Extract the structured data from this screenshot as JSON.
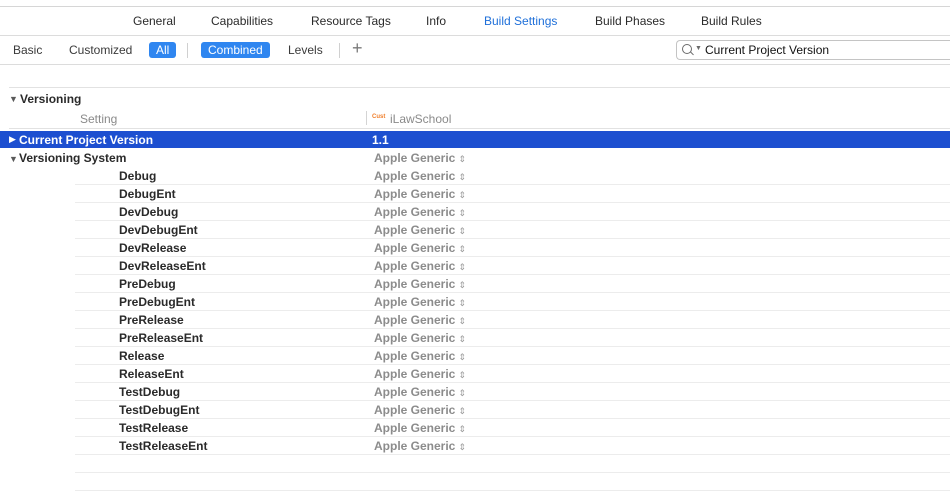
{
  "tabs": [
    {
      "label": "General",
      "active": false
    },
    {
      "label": "Capabilities",
      "active": false
    },
    {
      "label": "Resource Tags",
      "active": false
    },
    {
      "label": "Info",
      "active": false
    },
    {
      "label": "Build Settings",
      "active": true
    },
    {
      "label": "Build Phases",
      "active": false
    },
    {
      "label": "Build Rules",
      "active": false
    }
  ],
  "filter": {
    "basic": "Basic",
    "customized": "Customized",
    "all": "All",
    "combined": "Combined",
    "levels": "Levels",
    "add_icon": "plus-icon"
  },
  "search": {
    "value": "Current Project Version",
    "icon": "magnifier-icon"
  },
  "section": {
    "title": "Versioning"
  },
  "columns": {
    "setting": "Setting",
    "target": "iLawSchool",
    "target_icon_text": "Cust"
  },
  "selected_row": {
    "label": "Current Project Version",
    "value": "1.1"
  },
  "versioning_system": {
    "label": "Versioning System",
    "value": "Apple Generic",
    "configs": [
      {
        "name": "Debug",
        "value": "Apple Generic"
      },
      {
        "name": "DebugEnt",
        "value": "Apple Generic"
      },
      {
        "name": "DevDebug",
        "value": "Apple Generic"
      },
      {
        "name": "DevDebugEnt",
        "value": "Apple Generic"
      },
      {
        "name": "DevRelease",
        "value": "Apple Generic"
      },
      {
        "name": "DevReleaseEnt",
        "value": "Apple Generic"
      },
      {
        "name": "PreDebug",
        "value": "Apple Generic"
      },
      {
        "name": "PreDebugEnt",
        "value": "Apple Generic"
      },
      {
        "name": "PreRelease",
        "value": "Apple Generic"
      },
      {
        "name": "PreReleaseEnt",
        "value": "Apple Generic"
      },
      {
        "name": "Release",
        "value": "Apple Generic"
      },
      {
        "name": "ReleaseEnt",
        "value": "Apple Generic"
      },
      {
        "name": "TestDebug",
        "value": "Apple Generic"
      },
      {
        "name": "TestDebugEnt",
        "value": "Apple Generic"
      },
      {
        "name": "TestRelease",
        "value": "Apple Generic"
      },
      {
        "name": "TestReleaseEnt",
        "value": "Apple Generic"
      }
    ]
  },
  "colors": {
    "accent": "#2f86f0",
    "selection": "#1d4fd0",
    "active_tab": "#1e6fd9"
  }
}
